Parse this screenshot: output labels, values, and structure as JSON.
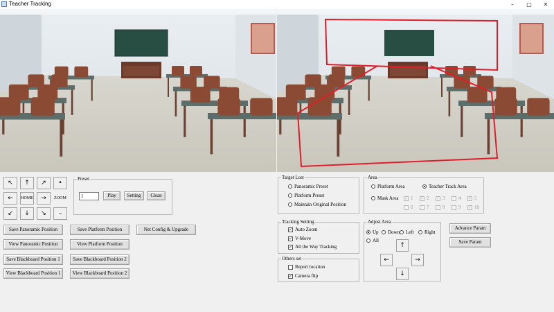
{
  "window": {
    "title": "Teacher Tracking",
    "minimize": "–",
    "maximize": "□",
    "close": "✕"
  },
  "accent": {
    "tracking_box": "#e01e2a"
  },
  "nav": {
    "home": "HOME",
    "zoom": "ZOOM",
    "dot": "•",
    "minus": "–",
    "up": "↑",
    "down": "↓",
    "left": "←",
    "right": "→",
    "up_left": "↖",
    "up_right": "↗",
    "down_left": "↙",
    "down_right": "↘"
  },
  "preset": {
    "title": "Preset",
    "value": "1",
    "play": "Play",
    "setting": "Setting",
    "clean": "Clean"
  },
  "positions": {
    "save_panoramic": "Save Panoramic Position",
    "save_platform": "Save Platform Position",
    "net_config": "Net Config & Upgrade",
    "view_panoramic": "View Panoramic Position",
    "view_platform": "View Platform Position",
    "save_blackboard_1": "Save Blackboard Position 1",
    "save_blackboard_2": "Save Blackboard Position 2",
    "view_blackboard_1": "View Blackboard Position 1",
    "view_blackboard_2": "View Blackboard Position 2"
  },
  "target_lost": {
    "title": "Target Lost",
    "options": [
      "Panoramic Preset",
      "Platform Preset",
      "Maintain Original Position"
    ]
  },
  "tracking_setting": {
    "title": "Tracking Setting",
    "items": [
      {
        "label": "Auto Zoom",
        "checked": true
      },
      {
        "label": "V-Move",
        "checked": true
      },
      {
        "label": "All the Way Tracking",
        "checked": true
      }
    ]
  },
  "others_set": {
    "title": "Others set",
    "items": [
      {
        "label": "Report location",
        "checked": false
      },
      {
        "label": "Camera flip",
        "checked": true
      }
    ]
  },
  "area": {
    "title": "Area",
    "platform_area": "Platform Area",
    "teacher_track_area": "Teacher Track Area",
    "selected": "Teacher Track Area",
    "mask_area": "Mask Area",
    "mask_numbers": [
      "1",
      "2",
      "3",
      "4",
      "5",
      "6",
      "7",
      "8",
      "9",
      "10"
    ]
  },
  "adjust_area": {
    "title": "Adjust Area",
    "options": [
      "Up",
      "Down",
      "Left",
      "Right",
      "All"
    ],
    "selected": "Up"
  },
  "advance_param": "Advance Param",
  "save_param": "Save Param"
}
